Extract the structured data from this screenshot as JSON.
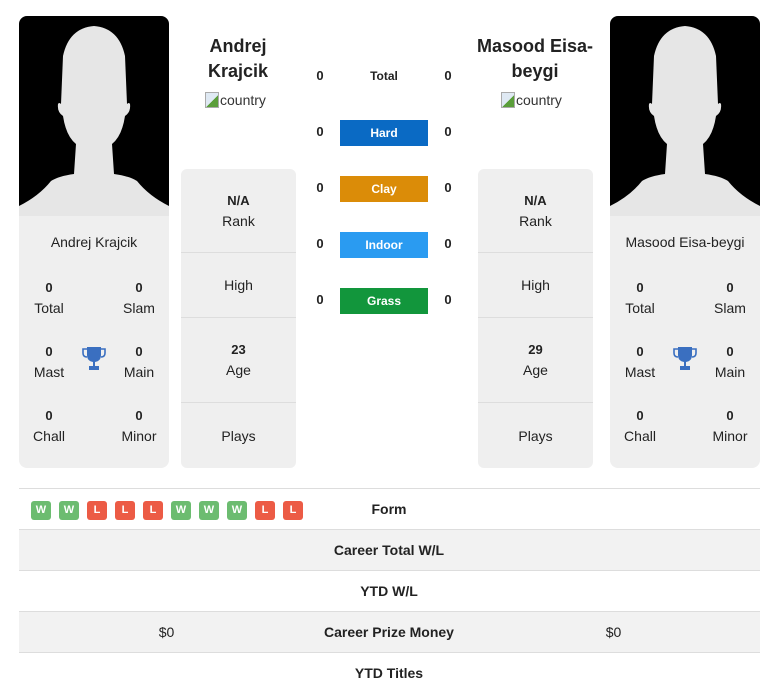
{
  "player1": {
    "name": "Andrej Krajcik",
    "name_line1": "Andrej",
    "name_line2": "Krajcik",
    "country_alt": "country",
    "rank": "N/A",
    "rank_label": "Rank",
    "high_label": "High",
    "age": "23",
    "age_label": "Age",
    "plays_label": "Plays",
    "titles": {
      "total": "0",
      "total_label": "Total",
      "slam": "0",
      "slam_label": "Slam",
      "mast": "0",
      "mast_label": "Mast",
      "main": "0",
      "main_label": "Main",
      "chall": "0",
      "chall_label": "Chall",
      "minor": "0",
      "minor_label": "Minor"
    },
    "form": [
      "W",
      "W",
      "L",
      "L",
      "L",
      "W",
      "W",
      "W",
      "L",
      "L"
    ],
    "career_prize_money": "$0"
  },
  "player2": {
    "name": "Masood Eisa-beygi",
    "name_line1": "Masood Eisa-",
    "name_line2": "beygi",
    "country_alt": "country",
    "rank": "N/A",
    "rank_label": "Rank",
    "high_label": "High",
    "age": "29",
    "age_label": "Age",
    "plays_label": "Plays",
    "titles": {
      "total": "0",
      "total_label": "Total",
      "slam": "0",
      "slam_label": "Slam",
      "mast": "0",
      "mast_label": "Mast",
      "main": "0",
      "main_label": "Main",
      "chall": "0",
      "chall_label": "Chall",
      "minor": "0",
      "minor_label": "Minor"
    },
    "career_prize_money": "$0"
  },
  "h2h": {
    "total": {
      "label": "Total",
      "p1": "0",
      "p2": "0"
    },
    "hard": {
      "label": "Hard",
      "p1": "0",
      "p2": "0",
      "color": "#0a6ac4"
    },
    "clay": {
      "label": "Clay",
      "p1": "0",
      "p2": "0",
      "color": "#db8c08"
    },
    "indoor": {
      "label": "Indoor",
      "p1": "0",
      "p2": "0",
      "color": "#2a9bf1"
    },
    "grass": {
      "label": "Grass",
      "p1": "0",
      "p2": "0",
      "color": "#12963c"
    }
  },
  "comparison": {
    "form_label": "Form",
    "career_total_wl_label": "Career Total W/L",
    "ytd_wl_label": "YTD W/L",
    "career_prize_money_label": "Career Prize Money",
    "ytd_titles_label": "YTD Titles"
  },
  "colors": {
    "win": "#6cbc70",
    "loss": "#ec5b45",
    "trophy": "#3a6fc0"
  }
}
